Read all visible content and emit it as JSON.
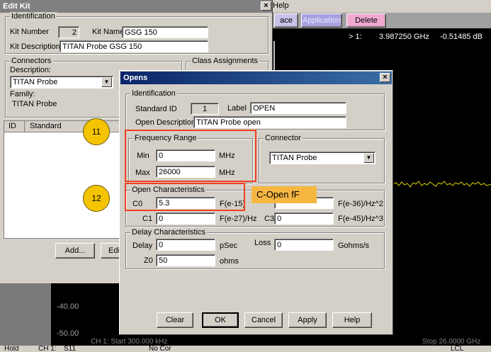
{
  "edit_kit": {
    "title": "Edit Kit",
    "close": "×",
    "identification": {
      "legend": "Identification",
      "kit_number_label": "Kit Number",
      "kit_number": "2",
      "kit_name_label": "Kit Name",
      "kit_name": "GSG 150",
      "kit_description_label": "Kit Description",
      "kit_description": "TITAN Probe GSG 150"
    },
    "connectors": {
      "legend": "Connectors",
      "description_label": "Description:",
      "description": "TITAN Probe",
      "family_label": "Family:",
      "family": "TITAN Probe"
    },
    "class_assignments_legend": "Class Assignments",
    "table_headers": [
      "ID",
      "Standard"
    ],
    "add_label": "Add...",
    "edit_label": "Edi"
  },
  "analyzer": {
    "help_menu": "Help",
    "buttons": [
      "ace",
      "Application",
      "Delete"
    ],
    "marker": "> 1:",
    "marker_freq": "3.987250 GHz",
    "marker_value": "-0.51485 dB",
    "y_ticks": [
      "-40.00",
      "-50.00"
    ],
    "bottom_partial": "CH 1: Start 300.000 kHz",
    "bottom_right_partial": "Stop 26.0000 GHz",
    "status": {
      "hold": "Hold",
      "channel": "CH 1:",
      "meas": "S11",
      "corr": "No Cor",
      "lcl": "LCL"
    }
  },
  "opens": {
    "title": "Opens",
    "close": "×",
    "identification": {
      "legend": "Identification",
      "standard_id_label": "Standard ID",
      "standard_id": "1",
      "label_label": "Label",
      "label_value": "OPEN",
      "open_description_label": "Open Description",
      "open_description": "TITAN Probe  open"
    },
    "frequency_range": {
      "legend": "Frequency Range",
      "min_label": "Min",
      "min": "0",
      "max_label": "Max",
      "max": "26000",
      "unit": "MHz"
    },
    "connector": {
      "legend": "Connector",
      "value": "TITAN Probe"
    },
    "open_characteristics": {
      "legend": "Open Characteristics",
      "c0_label": "C0",
      "c0": "5.3",
      "c0_unit": "F(e-15)",
      "c1_label": "C1",
      "c1": "0",
      "c1_unit": "F(e-27)/Hz",
      "c2_unit": "F(e-36)/Hz^2",
      "c3_label": "C3",
      "c3": "0",
      "c3_unit": "F(e-45)/Hz^3"
    },
    "delay": {
      "legend": "Delay Characteristics",
      "delay_label": "Delay",
      "delay": "0",
      "delay_unit": "pSec",
      "loss_label": "Loss",
      "loss": "0",
      "loss_unit": "Gohms/s",
      "z0_label": "Z0",
      "z0": "50",
      "z0_unit": "ohms"
    },
    "buttons": {
      "clear": "Clear",
      "ok": "OK",
      "cancel": "Cancel",
      "apply": "Apply",
      "help": "Help"
    }
  },
  "annotations": {
    "callout_11": "11",
    "callout_12": "12",
    "note": "C-Open fF",
    "box_color": "#f04020",
    "circle_color": "#f5c400",
    "note_color": "#f5b642"
  }
}
